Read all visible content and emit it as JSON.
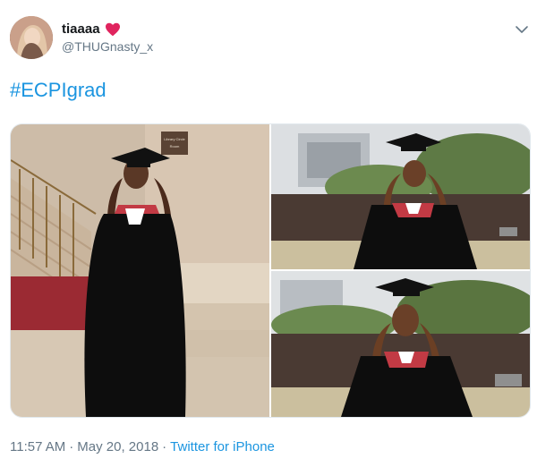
{
  "user": {
    "display_name": "tiaaaa",
    "handle": "@THUGnasty_x"
  },
  "tweet": {
    "text": "#ECPIgrad"
  },
  "meta": {
    "time": "11:57 AM",
    "separator": "·",
    "date": "May 20, 2018",
    "separator2": "·",
    "source": "Twitter for iPhone"
  },
  "media": {
    "sign_text_1": "Library Circle",
    "sign_text_2": "Room"
  },
  "icons": {
    "heart": "heart-icon",
    "chevron": "chevron-down-icon"
  },
  "colors": {
    "accent": "#1b95e0",
    "heart": "#e0245e",
    "secondary_text": "#657786"
  }
}
